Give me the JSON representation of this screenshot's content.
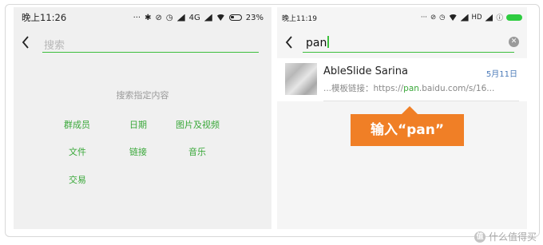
{
  "left_phone": {
    "status": {
      "time": "晚上11:26",
      "network": "4G",
      "battery": "23%"
    },
    "search": {
      "placeholder": "搜索"
    },
    "hint": "搜索指定内容",
    "categories": [
      "群成员",
      "日期",
      "图片及视频",
      "文件",
      "链接",
      "音乐",
      "交易"
    ]
  },
  "right_phone": {
    "status": {
      "time": "晚上11:19",
      "network": "HD"
    },
    "search": {
      "query": "pan",
      "clear_icon": "clear-icon"
    },
    "result": {
      "title": "AbleSlide Sarina",
      "date": "5月11日",
      "snippet_prefix": "...模板链接：https://",
      "snippet_highlight": "pan",
      "snippet_suffix": ".baidu.com/s/16..."
    },
    "annotation": "输入“pan”"
  },
  "watermark": {
    "text": "什么值得买",
    "badge": "值"
  },
  "colors": {
    "accent_green": "#3dbf3d",
    "callout_orange": "#f07f26",
    "date_blue": "#4a7ab8"
  }
}
